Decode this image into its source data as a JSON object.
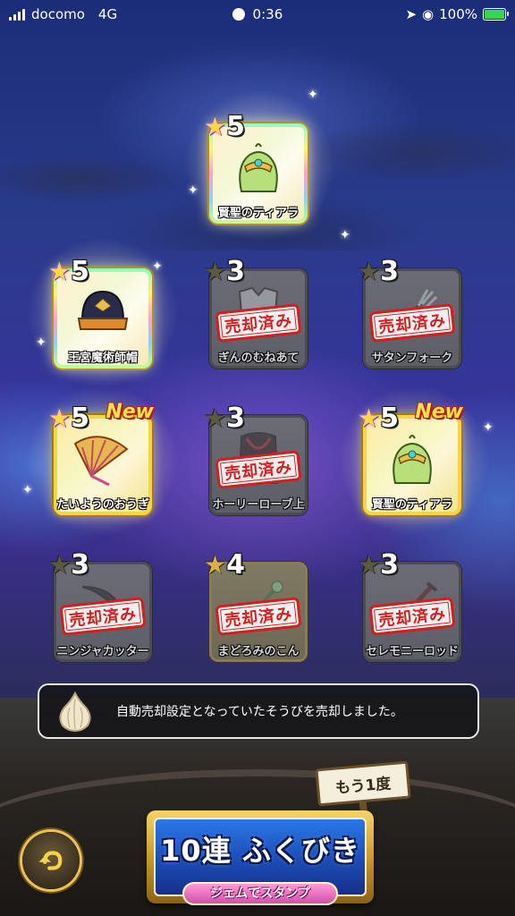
{
  "status_bar": {
    "carrier": "docomo",
    "network": "4G",
    "time": "0:36",
    "battery": "100%"
  },
  "items": [
    {
      "name": "賢聖のティアラ",
      "stars": "5",
      "rarity": "rainbow",
      "new": "",
      "sold": false,
      "art": "tiara-icon"
    },
    {
      "name": "王宮魔術師帽",
      "stars": "5",
      "rarity": "rainbow",
      "new": "",
      "sold": false,
      "art": "wizard-hat-icon"
    },
    {
      "name": "ぎんのむねあて",
      "stars": "3",
      "rarity": "gray",
      "new": "",
      "sold": true,
      "art": "chest-armor-icon"
    },
    {
      "name": "サタンフォーク",
      "stars": "3",
      "rarity": "gray",
      "new": "",
      "sold": true,
      "art": "fork-icon"
    },
    {
      "name": "たいようのおうぎ",
      "stars": "5",
      "rarity": "rainbow",
      "new": "New",
      "sold": false,
      "art": "fan-icon"
    },
    {
      "name": "ホーリーローブ上",
      "stars": "3",
      "rarity": "gray",
      "new": "",
      "sold": true,
      "art": "robe-icon"
    },
    {
      "name": "賢聖のティアラ",
      "stars": "5",
      "rarity": "rainbow",
      "new": "New",
      "sold": false,
      "art": "tiara-icon"
    },
    {
      "name": "ニンジャカッター",
      "stars": "3",
      "rarity": "gray",
      "new": "",
      "sold": true,
      "art": "boomerang-icon"
    },
    {
      "name": "まどろみのこん",
      "stars": "4",
      "rarity": "bronze",
      "new": "",
      "sold": true,
      "art": "staff-icon"
    },
    {
      "name": "セレモニーロッド",
      "stars": "3",
      "rarity": "gray",
      "new": "",
      "sold": true,
      "art": "rod-icon"
    }
  ],
  "sold_stamp": "売却済み",
  "message": {
    "text": "自動売却設定となっていたそうびを売却しました。",
    "icon": "garlic-gem-icon"
  },
  "controls": {
    "once_more": "もう1度",
    "gacha_title": "10連 ふくびき",
    "gacha_sub": "ジェムでスタンプ"
  },
  "colors": {
    "stamp_red": "#d31f1f",
    "gold": "#f5d44a",
    "new_yellow": "#ffe14a"
  }
}
